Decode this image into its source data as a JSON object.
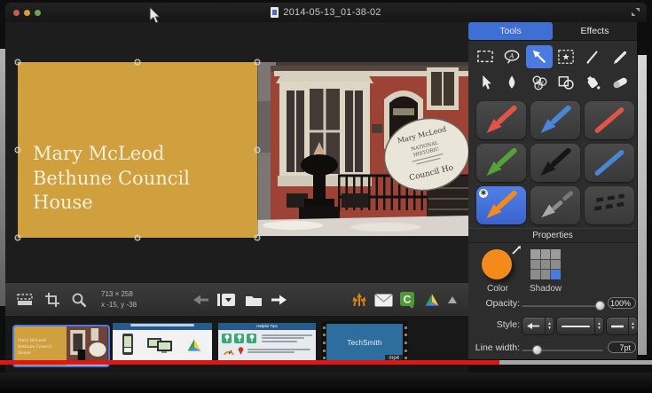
{
  "window": {
    "title": "2014-05-13_01-38-02",
    "controls": {
      "close": "close",
      "minimize": "minimize",
      "zoom": "zoom"
    }
  },
  "sidebar": {
    "tabs": [
      {
        "label": "Tools",
        "active": true
      },
      {
        "label": "Effects",
        "active": false
      }
    ],
    "tools": [
      "selection",
      "callout",
      "arrow",
      "stamp",
      "pen",
      "highlighter",
      "move",
      "blur",
      "step",
      "shape",
      "fill",
      "eraser"
    ],
    "presets": [
      {
        "name": "red-arrow"
      },
      {
        "name": "blue-arrow"
      },
      {
        "name": "red-line"
      },
      {
        "name": "green-arrow"
      },
      {
        "name": "black-arrow"
      },
      {
        "name": "blue-line"
      },
      {
        "name": "orange-arrow",
        "selected": true
      },
      {
        "name": "gray-segmented-arrow"
      },
      {
        "name": "dashed-line"
      }
    ],
    "properties": {
      "header": "Properties",
      "color_label": "Color",
      "shadow_label": "Shadow",
      "opacity_label": "Opacity:",
      "opacity_value": "100%",
      "style_label": "Style:",
      "line_width_label": "Line width:",
      "line_width_value": "7pt"
    }
  },
  "canvas": {
    "card_text": "Mary McLeod\nBethune Council\nHouse",
    "sign": {
      "line1": "Mary McLeod",
      "line2": "NATIONAL",
      "line3": "HISTORIC",
      "line4": "Council Ho"
    }
  },
  "toolbar": {
    "dimensions": "713 × 258",
    "coordinates": "x -15, y -38"
  },
  "filmstrip": {
    "thumb3_title": "Helpful Tips",
    "thumb4_brand": "TechSmith",
    "thumb4_badge": "mp4"
  },
  "colors": {
    "accent-blue": "#4b7be0",
    "tab-blue": "#3e6fd4",
    "card-yellow": "#cfa03d",
    "preset-red": "#e05548",
    "preset-blue": "#4a86d8",
    "preset-green": "#55a238",
    "preset-orange": "#f28a1c",
    "progress-red": "#df1712",
    "camtasia-green": "#4e9a35",
    "share-orange": "#d8821e"
  }
}
